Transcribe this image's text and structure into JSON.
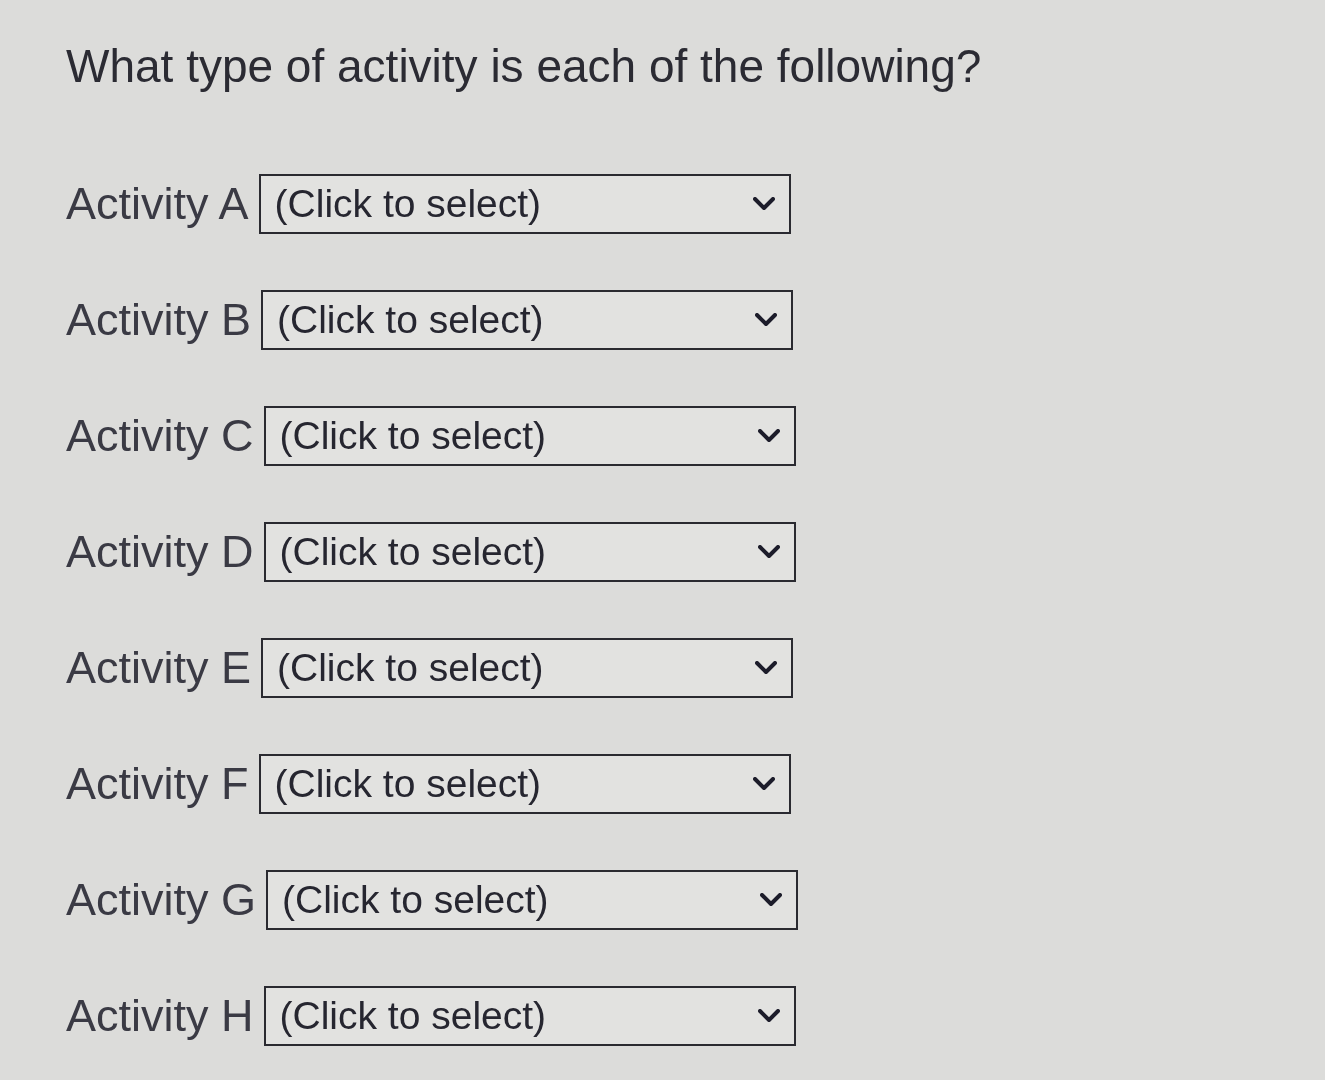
{
  "question": "What type of activity is each of the following?",
  "activities": [
    {
      "label": "Activity A",
      "dropdown": {
        "value": "(Click to select)"
      }
    },
    {
      "label": "Activity B",
      "dropdown": {
        "value": "(Click to select)"
      }
    },
    {
      "label": "Activity C",
      "dropdown": {
        "value": "(Click to select)"
      }
    },
    {
      "label": "Activity D",
      "dropdown": {
        "value": "(Click to select)"
      }
    },
    {
      "label": "Activity E",
      "dropdown": {
        "value": "(Click to select)"
      }
    },
    {
      "label": "Activity F",
      "dropdown": {
        "value": "(Click to select)"
      }
    },
    {
      "label": "Activity G",
      "dropdown": {
        "value": "(Click to select)"
      }
    },
    {
      "label": "Activity H",
      "dropdown": {
        "value": "(Click to select)"
      }
    }
  ]
}
